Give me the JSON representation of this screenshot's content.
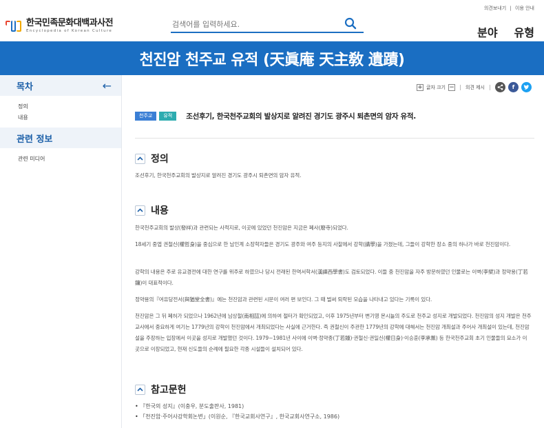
{
  "header": {
    "logo_ko": "한국민족문화대백과사전",
    "logo_en": "Encyclopedia of Korean Culture",
    "search_placeholder": "검색어를 입력하세요.",
    "top_links": [
      "의견보내기",
      "이용 안내"
    ],
    "nav": [
      "분야",
      "유형"
    ]
  },
  "title": "천진암 천주교 유적 (天眞庵 天主敎 遺蹟)",
  "sidebar": {
    "toc_title": "목차",
    "toc_items": [
      "정의",
      "내용"
    ],
    "related_title": "관련 정보",
    "related_items": [
      "관련 미디어"
    ]
  },
  "tools": {
    "font_size_label": "글자 크기",
    "feedback_label": "의견 제시"
  },
  "summary": {
    "tags": [
      "천주교",
      "유적"
    ],
    "text": "조선후기, 한국천주교회의 발상지로 알려진 경기도 광주시 퇴촌면의 암자 유적."
  },
  "sections": {
    "definition": {
      "title": "정의",
      "text": "조선후기, 한국천주교회의 발상지로 알려진 경기도 광주시 퇴촌면의 암자 유적."
    },
    "content": {
      "title": "내용",
      "paragraphs": [
        "한국천주교회의 발상(發祥)과 관련되는 사적지로, 이곳에 있었던 천진암은 지금은 폐사(廢寺)되었다.",
        "18세기 중엽 권철신(權哲身)을 중심으로 한 남인계 소장학자들은 경기도 광주와 여주 등지의 사찰에서 강학(講學)을 가졌는데, 그들이 강학한 장소 중의 하나가 바로 천진암이다.",
        "강학의 내용은 주로 유교경전에 대한 연구를 위주로 하였으나 당시 전래된 한역서학서(漢譯西學書)도 검토되었다. 이들 중 천진암을 자주 방문하였던 인물로는 이벽(李檗)과 정약용(丁若鏞)이 대표적이다.",
        "정약용의『여유당전서(與猶堂全書)』에는 천진암과 관련된 시문이 여러 편 보인다. 그 때 벌써 퇴락된 모습을 나타내고 있다는 기록이 있다.",
        "천진암은 그 뒤 폐허가 되었으나 1962년에 남상철(南相喆)에 의하여 절터가 확인되었고, 이후 1975년부터 변기영 몬시뇰의 주도로 천주교 성지로 개발되었다. 천진암의 성지 개발은 천주교사에서 중요하게 여기는 1779년의 강학이 천진암에서 개최되었다는 사실에 근거한다. 즉 권철신이 주관한 1779년의 강학에 대해서는 천진암 개최설과 주어사 개최설이 있는데, 천진암설을 주장하는 입장에서 이곳을 성지로 개발했던 것이다. 1979∼1981년 사이에 이벽·정약종(丁若鍾)·권철신·권일신(權日身)·이승훈(李承薰) 등 한국천주교회 초기 인물들의 묘소가 이곳으로 이장되었고, 현재 신도들의 순례에 필요한 각종 시설들이 설치되어 있다."
      ]
    },
    "references": {
      "title": "참고문헌",
      "items": [
        "『한국의 성지』(이충우, 분도출판사, 1981)",
        "「천진암·주어사강학회논변」(이원순, 『한국교회사연구』, 한국교회사연구소, 1986)"
      ]
    }
  },
  "colors": {
    "brand_blue": "#1a6ec2",
    "tag_blue": "#3a7fd5",
    "tag_teal": "#2dacb0"
  }
}
